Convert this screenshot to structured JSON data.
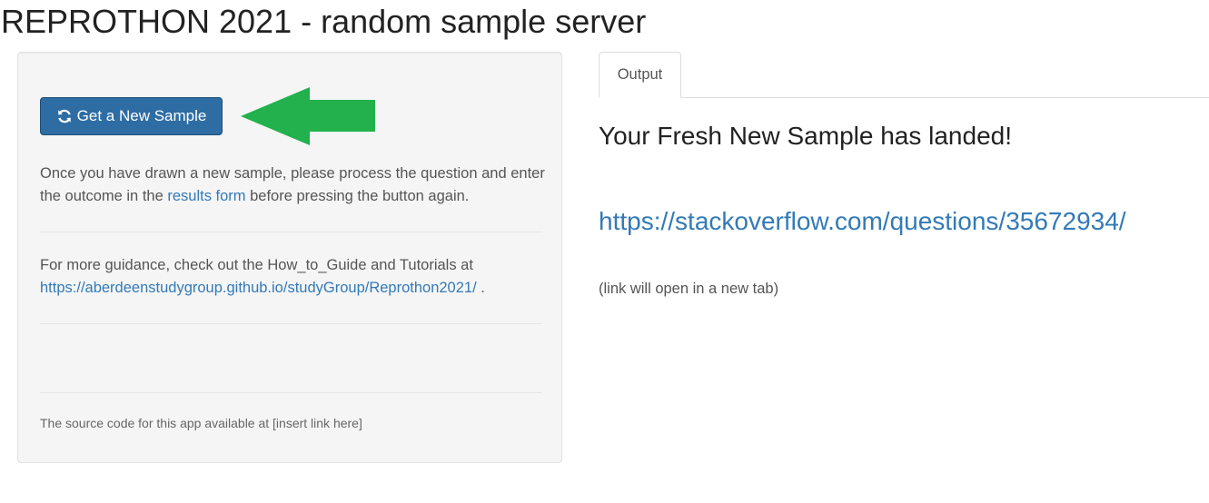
{
  "title": "REPROTHON 2021 - random sample server",
  "sidebar": {
    "button_label": "Get a New Sample",
    "button_icon": "refresh-icon",
    "arrow_icon": "arrow-left-icon",
    "arrow_color": "#22b14c",
    "instructions_before": "Once you have drawn a new sample, please process the question and enter the outcome in the ",
    "results_form_link": "results form",
    "instructions_after": " before pressing the button again.",
    "guidance_text": "For more guidance, check out the How_to_Guide and Tutorials at",
    "guidance_link": "https://aberdeenstudygroup.github.io/studyGroup/Reprothon2021/",
    "guidance_suffix": " .",
    "source_note": "The source code for this app available at [insert link here]"
  },
  "main": {
    "tabs": [
      {
        "label": "Output",
        "active": true
      }
    ],
    "heading": "Your Fresh New Sample has landed!",
    "sample_link": "https://stackoverflow.com/questions/35672934/",
    "note": "(link will open in a new tab)"
  },
  "colors": {
    "button_bg": "#2e6da4",
    "link": "#337ab7",
    "sidebar_bg": "#f5f5f5"
  }
}
